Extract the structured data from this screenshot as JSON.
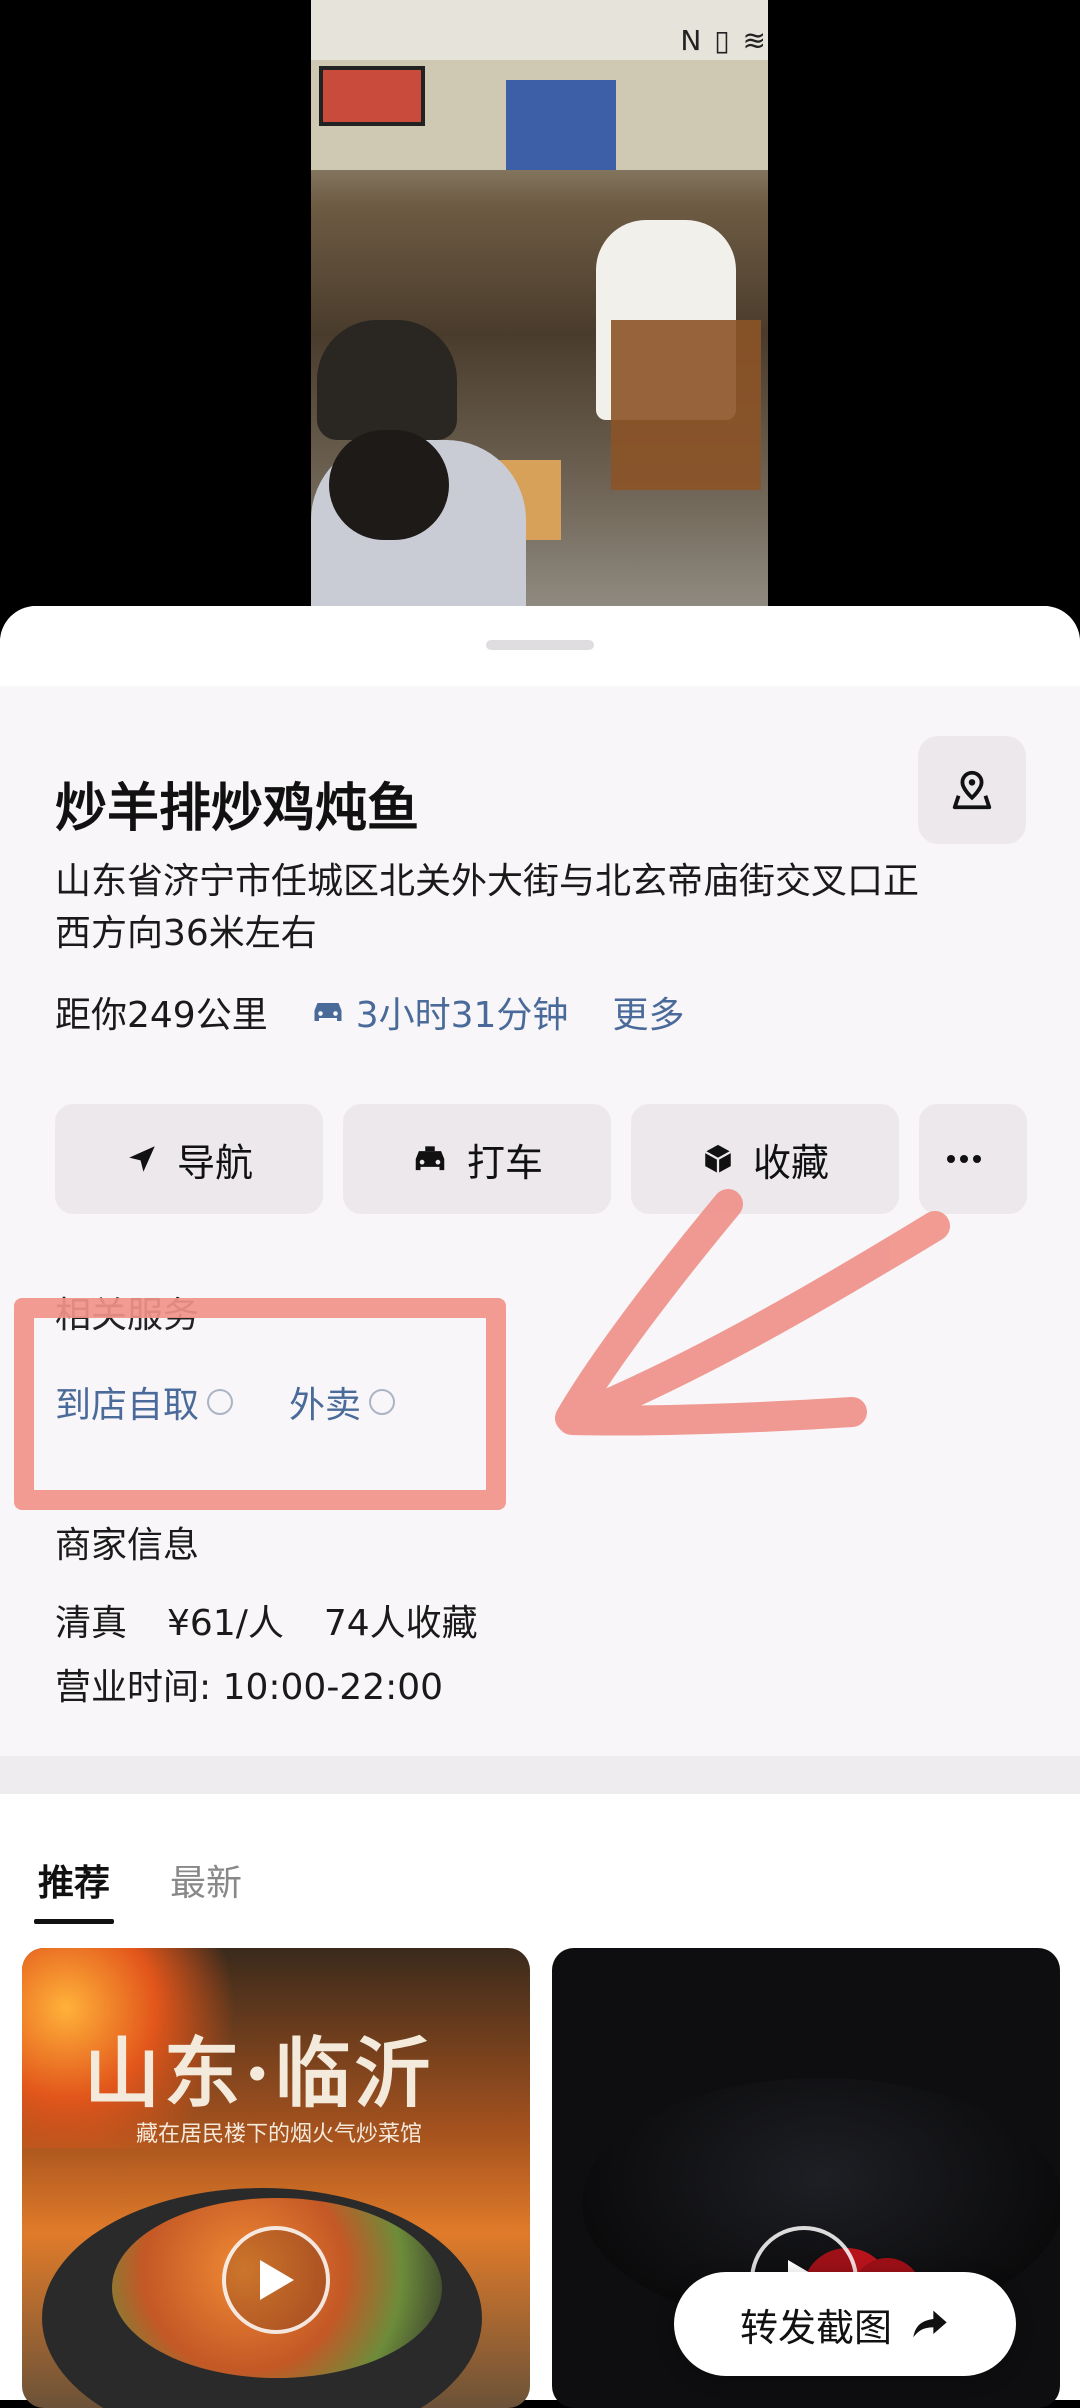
{
  "restaurant": {
    "name": "炒羊排炒鸡炖鱼",
    "address": "山东省济宁市任城区北关外大街与北玄帝庙街交叉口正西方向36米左右",
    "distance": "距你249公里",
    "drive_time": "3小时31分钟",
    "more": "更多"
  },
  "actions": {
    "navigate": "导航",
    "taxi": "打车",
    "favorite": "收藏"
  },
  "related_services": {
    "label": "相关服务",
    "items": [
      "到店自取",
      "外卖"
    ]
  },
  "merchant": {
    "label": "商家信息",
    "tag": "清真",
    "price": "¥61/人",
    "favorites": "74人收藏",
    "hours": "营业时间: 10:00-22:00"
  },
  "feed": {
    "tabs": [
      "推荐",
      "最新"
    ],
    "card1": {
      "headline": "山东·临沂",
      "subline": "藏在居民楼下的烟火气炒菜馆"
    }
  },
  "share_button": "转发截图",
  "annotation_color": "#f0928a",
  "link_color": "#4a6b9a"
}
